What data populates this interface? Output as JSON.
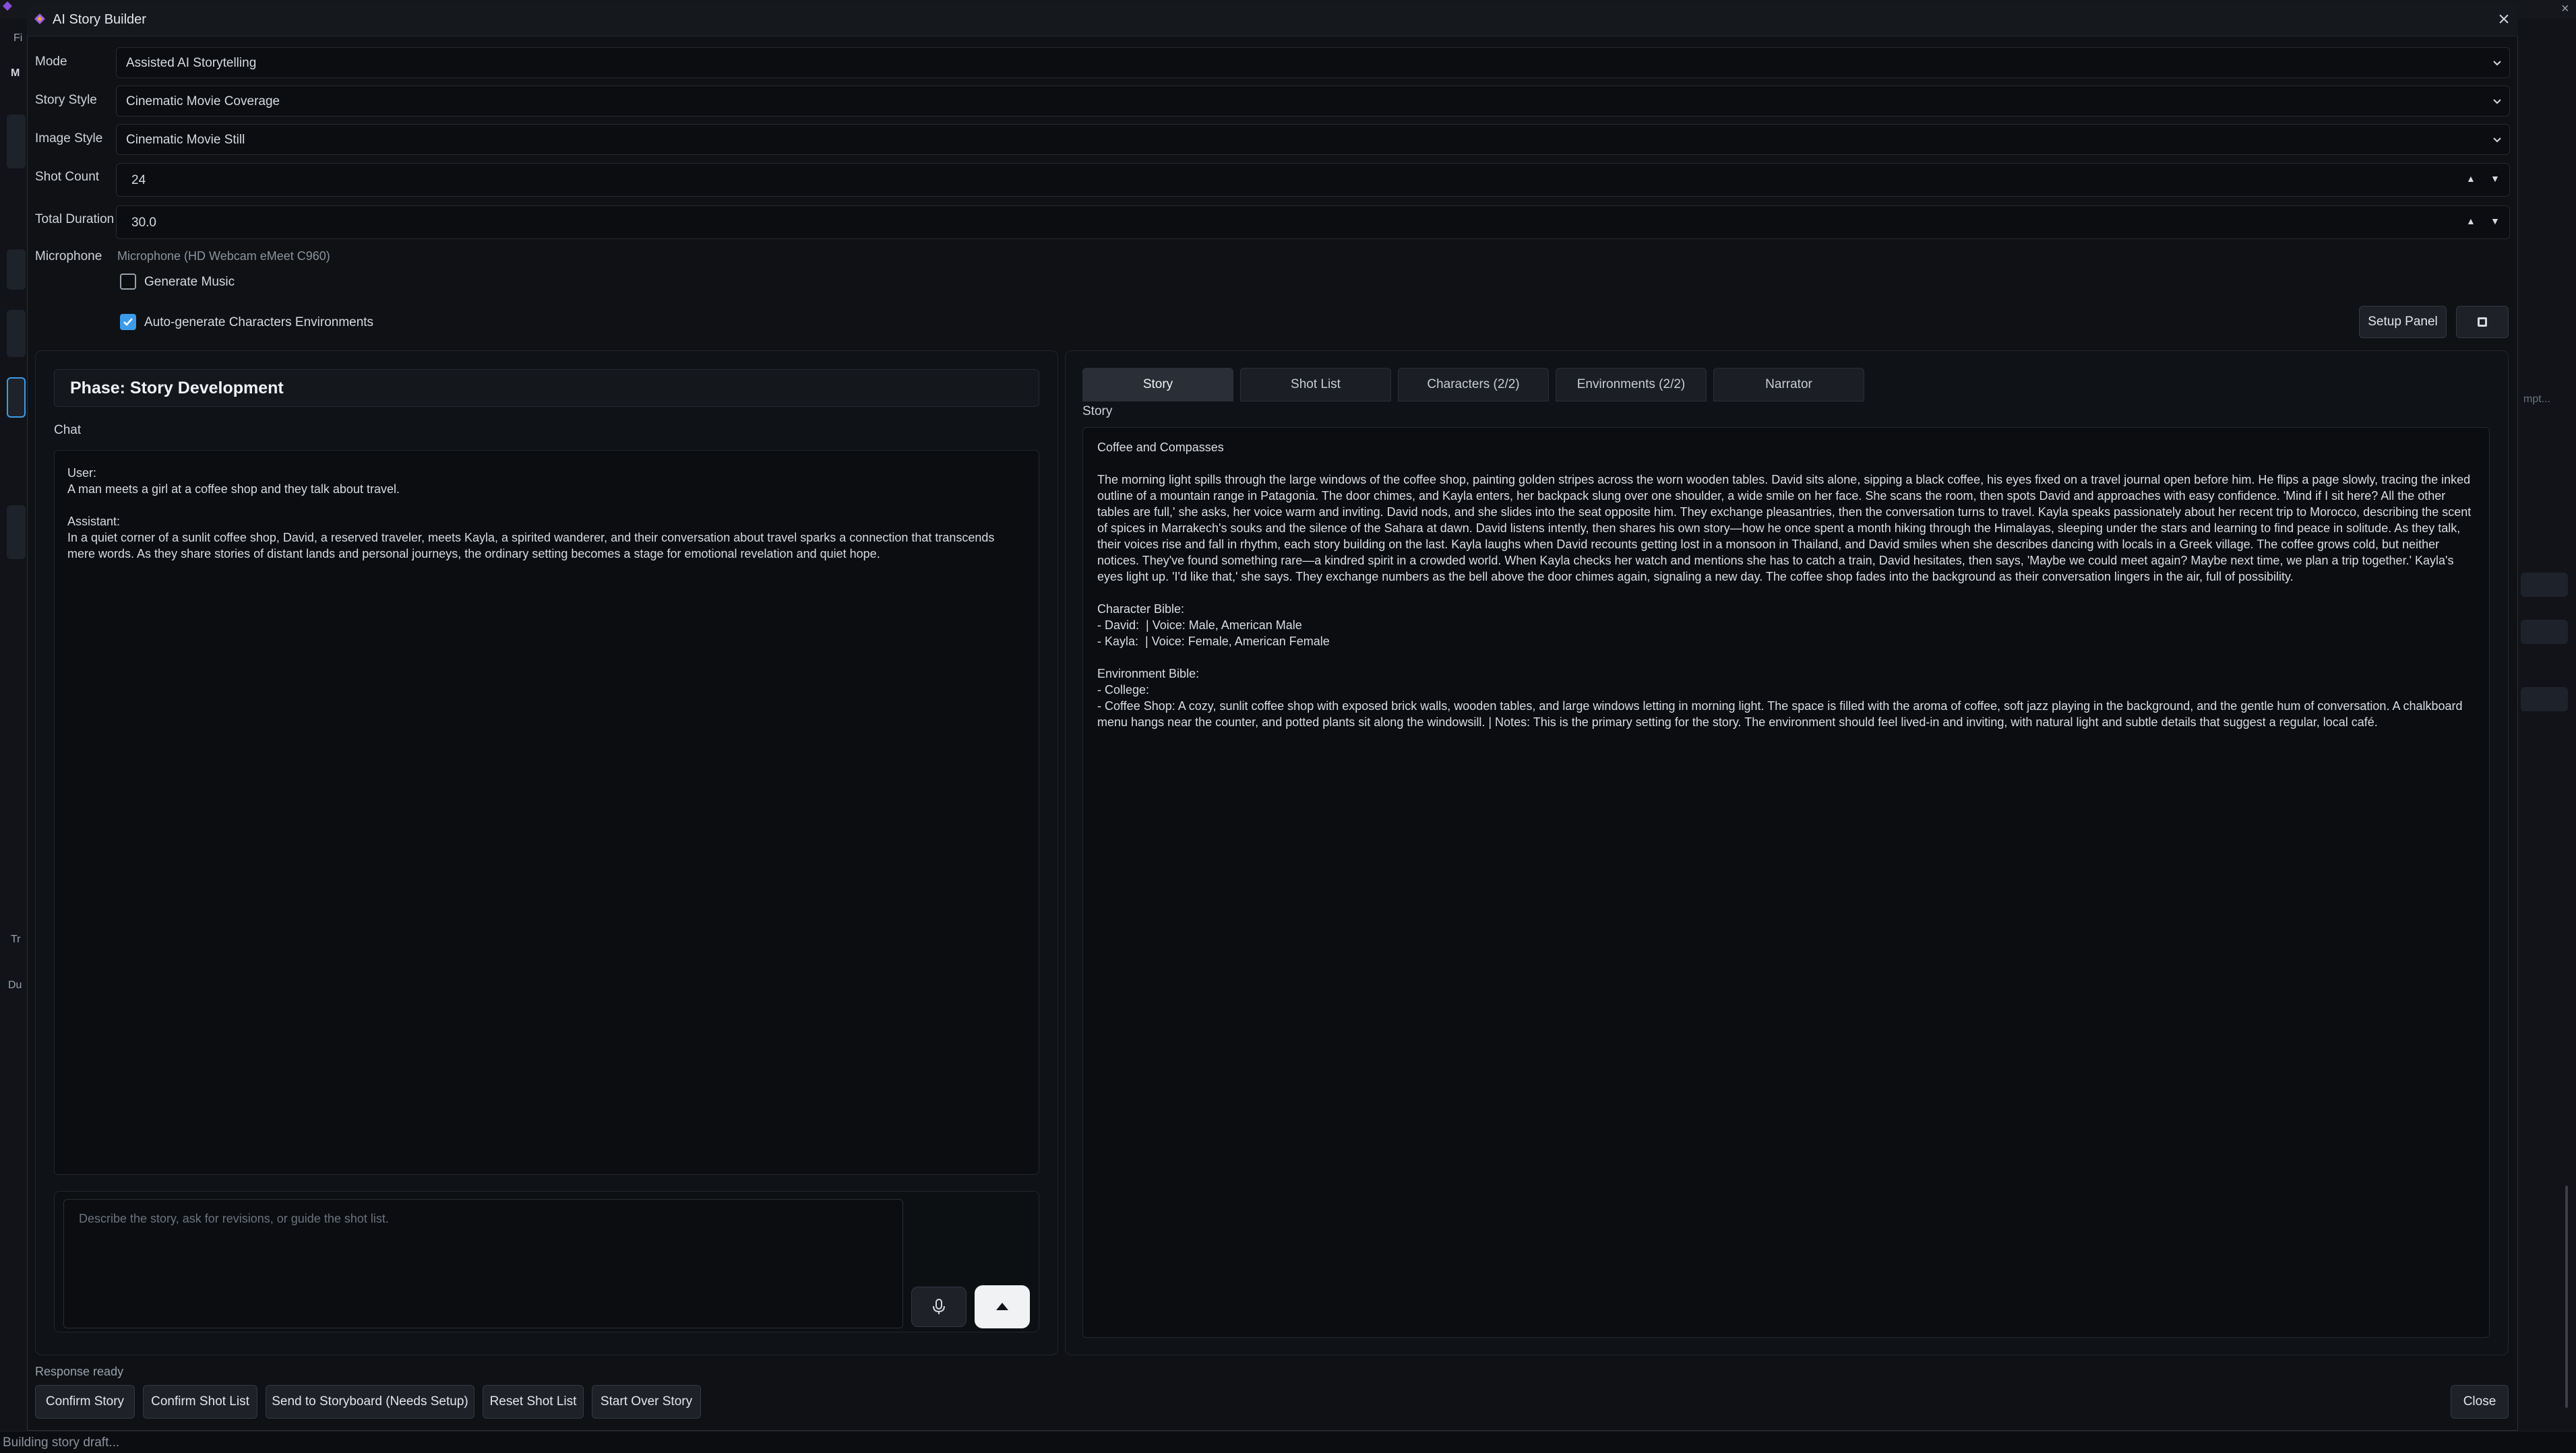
{
  "background_app": {
    "partial_labels": [
      "Fi",
      "M",
      "Tr",
      "Du",
      "mpt..."
    ]
  },
  "dialog": {
    "title": "AI Story Builder",
    "close_glyph": "×"
  },
  "form": {
    "mode": {
      "label": "Mode",
      "value": "Assisted AI Storytelling"
    },
    "story_style": {
      "label": "Story Style",
      "value": "Cinematic Movie Coverage"
    },
    "image_style": {
      "label": "Image Style",
      "value": "Cinematic Movie Still"
    },
    "shot_count": {
      "label": "Shot Count",
      "value": "24"
    },
    "total_duration": {
      "label": "Total Duration",
      "value": "30.0"
    },
    "microphone": {
      "label": "Microphone",
      "value": "Microphone (HD Webcam eMeet C960)"
    },
    "generate_music": {
      "label": "Generate Music",
      "checked": false
    },
    "auto_generate": {
      "label": "Auto-generate Characters  Environments",
      "checked": true
    },
    "setup_panel_label": "Setup Panel"
  },
  "left_panel": {
    "phase_title": "Phase: Story Development",
    "chat_label": "Chat",
    "messages": [
      {
        "role": "User:",
        "text": "A man meets a girl at a coffee shop and they talk about travel."
      },
      {
        "role": "Assistant:",
        "text": "In a quiet corner of a sunlit coffee shop, David, a reserved traveler, meets Kayla, a spirited wanderer, and their conversation about travel sparks a connection that transcends mere words. As they share stories of distant lands and personal journeys, the ordinary setting becomes a stage for emotional revelation and quiet hope."
      }
    ],
    "input_placeholder": "Describe the story, ask for revisions, or guide the shot list."
  },
  "right_panel": {
    "tabs": [
      "Story",
      "Shot List",
      "Characters (2/2)",
      "Environments (2/2)",
      "Narrator"
    ],
    "active_tab": "Story",
    "section_label": "Story",
    "story_title": "Coffee and Compasses",
    "story_body": "The morning light spills through the large windows of the coffee shop, painting golden stripes across the worn wooden tables. David sits alone, sipping a black coffee, his eyes fixed on a travel journal open before him. He flips a page slowly, tracing the inked outline of a mountain range in Patagonia. The door chimes, and Kayla enters, her backpack slung over one shoulder, a wide smile on her face. She scans the room, then spots David and approaches with easy confidence. 'Mind if I sit here? All the other tables are full,' she asks, her voice warm and inviting. David nods, and she slides into the seat opposite him. They exchange pleasantries, then the conversation turns to travel. Kayla speaks passionately about her recent trip to Morocco, describing the scent of spices in Marrakech's souks and the silence of the Sahara at dawn. David listens intently, then shares his own story—how he once spent a month hiking through the Himalayas, sleeping under the stars and learning to find peace in solitude. As they talk, their voices rise and fall in rhythm, each story building on the last. Kayla laughs when David recounts getting lost in a monsoon in Thailand, and David smiles when she describes dancing with locals in a Greek village. The coffee grows cold, but neither notices. They've found something rare—a kindred spirit in a crowded world. When Kayla checks her watch and mentions she has to catch a train, David hesitates, then says, 'Maybe we could meet again? Maybe next time, we plan a trip together.' Kayla's eyes light up. 'I'd like that,' she says. They exchange numbers as the bell above the door chimes again, signaling a new day. The coffee shop fades into the background as their conversation lingers in the air, full of possibility.",
    "character_bible": "Character Bible:\n- David:  | Voice: Male, American Male\n- Kayla:  | Voice: Female, American Female",
    "environment_bible": "Environment Bible:\n- College:\n- Coffee Shop: A cozy, sunlit coffee shop with exposed brick walls, wooden tables, and large windows letting in morning light. The space is filled with the aroma of coffee, soft jazz playing in the background, and the gentle hum of conversation. A chalkboard menu hangs near the counter, and potted plants sit along the windowsill. | Notes: This is the primary setting for the story. The environment should feel lived-in and inviting, with natural light and subtle details that suggest a regular, local café."
  },
  "footer": {
    "response_status": "Response ready",
    "buttons": [
      "Confirm Story",
      "Confirm Shot List",
      "Send to Storyboard (Needs Setup)",
      "Reset Shot List",
      "Start Over Story"
    ],
    "close_label": "Close"
  },
  "status_bar": {
    "text": "Building story draft..."
  },
  "colors": {
    "accent": "#3d9be9",
    "background": "#0d0f13",
    "panel": "#0f1216",
    "active_tab": "#2a2e36"
  },
  "icons": [
    "app-logo-icon",
    "close-icon",
    "chevron-down-icon",
    "spin-up-icon",
    "spin-down-icon",
    "stop-square-icon",
    "microphone-icon",
    "send-arrow-icon",
    "checkmark-icon"
  ]
}
